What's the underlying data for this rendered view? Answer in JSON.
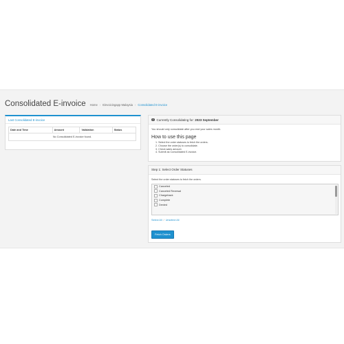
{
  "header": {
    "title": "Consolidated E-invoice",
    "breadcrumb": [
      "Home",
      "Einvoicingapp Malaysia",
      "Consolidated E-invoice"
    ]
  },
  "last_panel": {
    "title": "Last Consolidated E-invoice",
    "columns": [
      "Date and Time",
      "Amount",
      "Validation",
      "Status"
    ],
    "empty_message": "No Consolidated E-invoice found."
  },
  "current_panel": {
    "label": "Currently Consolidating for:",
    "period": "2023 September",
    "note": "You should only consolidate after you end your sales month.",
    "howto_title": "How to use this page",
    "steps": [
      "1. Select the order statuses to fetch the orders.",
      "2. Choose the order(s) to consolidate.",
      "3. Check sales amount.",
      "4. Submit as Consolidated E-invoice."
    ]
  },
  "step1_panel": {
    "title": "Step 1: Select Order Statuses",
    "note": "Select the order statuses to fetch the orders.",
    "statuses": [
      "Canceled",
      "Canceled Reversal",
      "Chargeback",
      "Complete",
      "Denied"
    ],
    "select_all": "Select All",
    "unselect_all": "Unselect All",
    "fetch_button": "Fetch Orders"
  },
  "colors": {
    "accent": "#1e91cf",
    "background": "#f3f3f3"
  }
}
